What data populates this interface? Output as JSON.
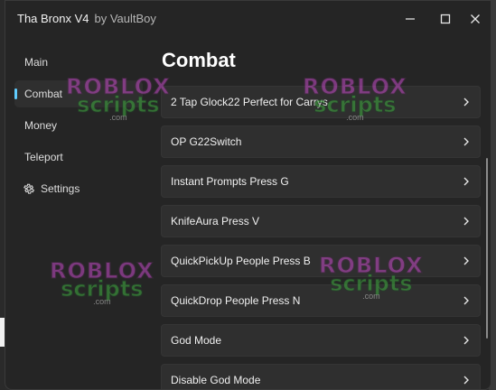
{
  "window": {
    "title": "Tha Bronx V4",
    "subtitle": "by VaultBoy",
    "controls": [
      {
        "name": "minimize",
        "icon": "minimize-icon"
      },
      {
        "name": "maximize",
        "icon": "maximize-icon"
      },
      {
        "name": "close",
        "icon": "close-icon"
      }
    ]
  },
  "sidebar": {
    "items": [
      {
        "label": "Main",
        "active": false
      },
      {
        "label": "Combat",
        "active": true
      },
      {
        "label": "Money",
        "active": false
      },
      {
        "label": "Teleport",
        "active": false
      },
      {
        "label": "Settings",
        "active": false,
        "icon": "gear-icon"
      }
    ]
  },
  "main": {
    "title": "Combat",
    "items": [
      {
        "label": "2 Tap Glock22 Perfect for Carrys"
      },
      {
        "label": "OP G22Switch"
      },
      {
        "label": "Instant Prompts Press G"
      },
      {
        "label": "KnifeAura Press V"
      },
      {
        "label": "QuickPickUp People Press B"
      },
      {
        "label": "QuickDrop People Press N"
      },
      {
        "label": "God Mode"
      },
      {
        "label": "Disable God Mode"
      }
    ]
  },
  "watermark": {
    "line1": "ROBLOX",
    "line2": "scripts",
    "line3": ".com"
  },
  "colors": {
    "accent": "#60cdff",
    "background": "#252525",
    "row": "#2f2f2f"
  }
}
